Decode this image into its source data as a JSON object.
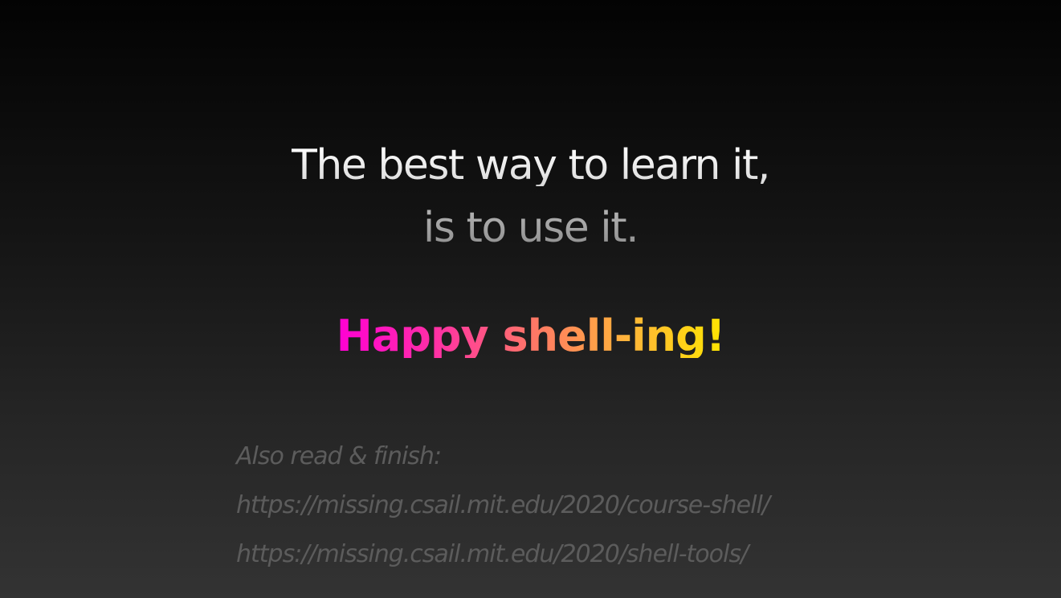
{
  "slide": {
    "line1": "The best way to learn it,",
    "line2": "is to use it.",
    "tagline": "Happy shell-ing!",
    "footer": {
      "label": "Also read & finish:",
      "links": [
        "https://missing.csail.mit.edu/2020/course-shell/",
        "https://missing.csail.mit.edu/2020/shell-tools/"
      ]
    }
  },
  "colors": {
    "background_top": "#030303",
    "background_bottom": "#333333",
    "tagline_gradient": [
      "#ff00d4",
      "#ff7a63",
      "#ffe600"
    ],
    "footer_text": "#5c5c5c"
  }
}
